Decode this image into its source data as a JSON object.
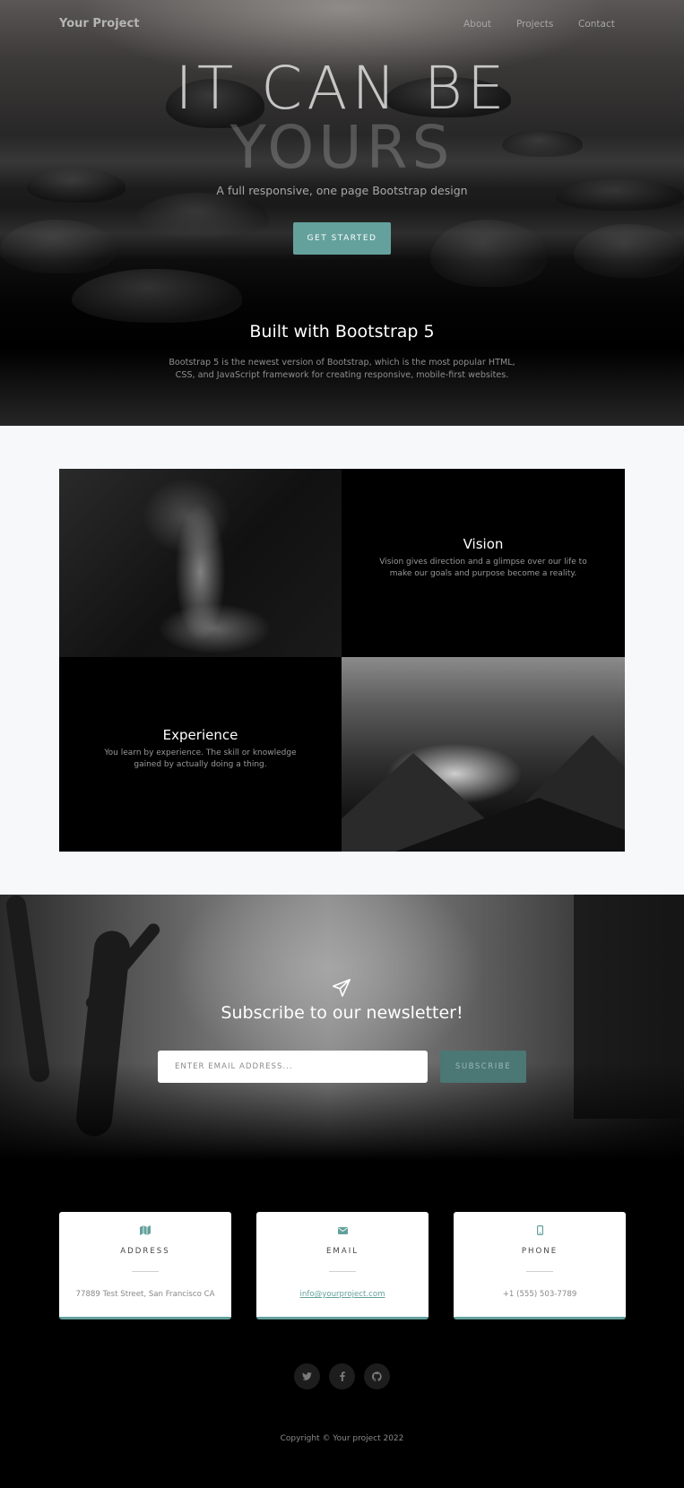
{
  "nav": {
    "brand": "Your Project",
    "links": [
      {
        "label": "About"
      },
      {
        "label": "Projects"
      },
      {
        "label": "Contact"
      }
    ]
  },
  "hero": {
    "title_line1": "IT CAN BE",
    "title_line2": "YOURS",
    "subtitle": "A full responsive, one page Bootstrap design",
    "cta_label": "GET STARTED"
  },
  "about": {
    "title": "Built with Bootstrap 5",
    "description": "Bootstrap 5 is the newest version of Bootstrap, which is the most popular HTML, CSS, and JavaScript framework for creating responsive, mobile-first websites."
  },
  "projects": [
    {
      "title": "Vision",
      "description": "Vision gives direction and a glimpse over our life to make our goals and purpose become a reality."
    },
    {
      "title": "Experience",
      "description": "You learn by experience. The skill or knowledge gained by actually doing a thing."
    }
  ],
  "newsletter": {
    "title": "Subscribe to our newsletter!",
    "input_placeholder": "ENTER EMAIL ADDRESS...",
    "button_label": "SUBSCRIBE",
    "icon": "paper-plane-icon"
  },
  "contact": [
    {
      "icon": "map-icon",
      "label": "ADDRESS",
      "value": "77889 Test Street, San Francisco CA"
    },
    {
      "icon": "envelope-icon",
      "label": "EMAIL",
      "value": "info@yourproject.com"
    },
    {
      "icon": "mobile-icon",
      "label": "PHONE",
      "value": "+1 (555) 503-7789"
    }
  ],
  "social": [
    {
      "icon": "twitter-icon"
    },
    {
      "icon": "facebook-icon"
    },
    {
      "icon": "github-icon"
    }
  ],
  "footer": {
    "copyright": "Copyright © Your project 2022"
  },
  "colors": {
    "accent": "#64a19d",
    "page_bg": "#f7f8fa",
    "dark_bg": "#000000"
  }
}
